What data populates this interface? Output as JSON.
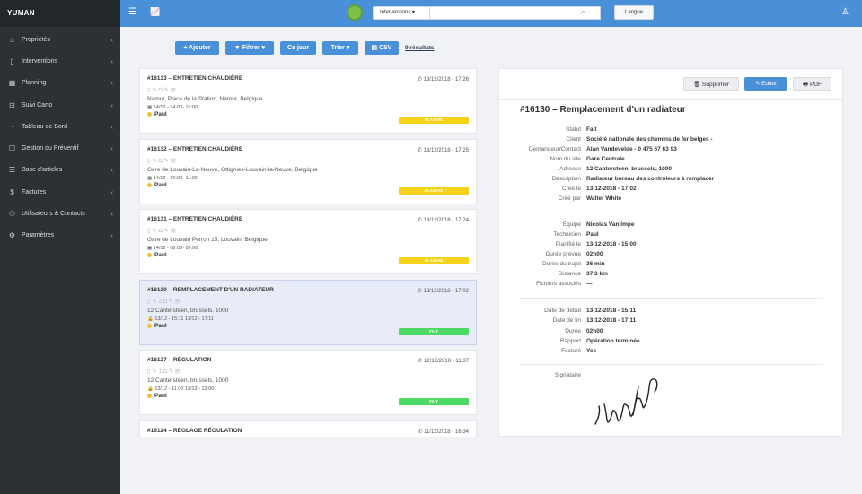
{
  "sidebar": {
    "logo": "YUMAN",
    "items": [
      {
        "label": "Propriétés",
        "icon": "home-icon",
        "glyph": "⌂",
        "chevron": true
      },
      {
        "label": "Interventions",
        "icon": "mobile-icon",
        "glyph": "▯",
        "chevron": true
      },
      {
        "label": "Planning",
        "icon": "calendar-icon",
        "glyph": "▦",
        "chevron": true
      },
      {
        "label": "Suivi Carto",
        "icon": "map-icon",
        "glyph": "⊡",
        "chevron": true
      },
      {
        "label": "Tableau de Bord",
        "icon": "dashboard-icon",
        "glyph": "◔",
        "chevron": true
      },
      {
        "label": "Gestion du Préventif",
        "icon": "square-icon",
        "glyph": "☐",
        "chevron": true
      },
      {
        "label": "Base d'articles",
        "icon": "list-icon",
        "glyph": "☰",
        "chevron": true
      },
      {
        "label": "Factures",
        "icon": "dollar-icon",
        "glyph": "$",
        "chevron": true
      },
      {
        "label": "Utilisateurs & Contacts",
        "icon": "users-icon",
        "glyph": "⚇",
        "chevron": true
      },
      {
        "label": "Paramètres",
        "icon": "gear-icon",
        "glyph": "⚙",
        "chevron": true
      }
    ]
  },
  "topbar": {
    "menu_icon": "☰",
    "chart_icon": "📈",
    "select_value": "Interventions ▾",
    "search_placeholder": "",
    "search_icon": "⌕",
    "language_button": "Langue",
    "user_icon": "♙"
  },
  "toolbar": {
    "add": "+ Ajouter",
    "filter": "▼ Filtrer ▾",
    "today": "Ce jour",
    "sort": "Trier ▾",
    "csv": "▤ CSV",
    "results": "9 résultats"
  },
  "list": [
    {
      "title": "#16133 – ENTRETIEN CHAUDIÈRE",
      "date": "13/12/2018 - 17:26",
      "icons": "▯ ✎ ◘ ✎ ▤",
      "address": "Namur, Place de la Station, Namur, Belgique",
      "slot": "▦ 14/12 - 14:00- 15:00",
      "tech": "Paul",
      "status": "PLANIFIÉ",
      "status_class": "planifie",
      "active": false
    },
    {
      "title": "#16132 – ENTRETIEN CHAUDIÈRE",
      "date": "13/12/2018 - 17:25",
      "icons": "▯ ✎ ◘ ✎ ▤",
      "address": "Gare de Louvain-La-Neuve, Ottignies-Louvain-la-Neuve, Belgique",
      "slot": "▦ 14/12 - 10:00- 11:00",
      "tech": "Paul",
      "status": "PLANIFIÉ",
      "status_class": "planifie",
      "active": false
    },
    {
      "title": "#16131 – ENTRETIEN CHAUDIÈRE",
      "date": "13/12/2018 - 17:24",
      "icons": "▯ ✎ ◘ ✎ ▤",
      "address": "Gare de Louvain Perron 15, Louvain, Belgique",
      "slot": "▦ 14/12 - 08:00- 09:00",
      "tech": "Paul",
      "status": "PLANIFIÉ",
      "status_class": "planifie",
      "active": false
    },
    {
      "title": "#16130 – REMPLACEMENT D'UN RADIATEUR",
      "date": "13/12/2018 - 17:02",
      "icons": "▯ ✎ 2 ◘ ✎ ▤",
      "address": "12 Cantersteen, brussels, 1000",
      "slot": "🔒 13/12 - 15:11 13/12 - 17:11",
      "tech": "Paul",
      "status": "FAIT",
      "status_class": "fait",
      "active": true
    },
    {
      "title": "#16127 – RÉGULATION",
      "date": "12/12/2018 - 11:37",
      "icons": "▯ ✎ 1 ◘ ✎ ▤",
      "address": "12 Cantersteen, brussels, 1000",
      "slot": "🔒 13/12 - 11:00 13/12 - 12:00",
      "tech": "Paul",
      "status": "FAIT",
      "status_class": "fait",
      "active": false
    },
    {
      "title": "#16124 – RÉGLAGE RÉGULATION",
      "date": "11/12/2018 - 16:34",
      "icons": "",
      "address": "",
      "slot": "",
      "tech": "",
      "status": "",
      "status_class": "",
      "active": false
    }
  ],
  "detail": {
    "delete": "🗑 Supprimer",
    "edit": "✎ Editer",
    "pdf": "🖶 PDF",
    "title": "#16130 – Remplacement d'un radiateur",
    "group1": [
      {
        "k": "Statut",
        "v": "Fait"
      },
      {
        "k": "Client",
        "v": "Société nationale des chemins de fer belges -"
      },
      {
        "k": "Demandeur/Contact",
        "v": "Alan Vandevelde - 0 475 67 63 93"
      },
      {
        "k": "Nom du site",
        "v": "Gare Centrale"
      },
      {
        "k": "Adresse",
        "v": "12 Cantersteen, brussels, 1000"
      },
      {
        "k": "Description",
        "v": "Radiateur bureau des contrôleurs à remplacer"
      },
      {
        "k": "Créé le",
        "v": "13-12-2018 - 17:02"
      },
      {
        "k": "Créé par",
        "v": "Walter White"
      }
    ],
    "group2": [
      {
        "k": "Equipe",
        "v": "Nicolas Van Impe"
      },
      {
        "k": "Technicien",
        "v": "Paul"
      },
      {
        "k": "Planifié le",
        "v": "13-12-2018 - 15:00"
      },
      {
        "k": "Durée prévue",
        "v": "02h00"
      },
      {
        "k": "Durée du trajet",
        "v": "36 min"
      },
      {
        "k": "Distance",
        "v": "37.3 km"
      },
      {
        "k": "Fichiers associés",
        "v": "—"
      }
    ],
    "group3": [
      {
        "k": "Date de début",
        "v": "13-12-2018 - 15:11"
      },
      {
        "k": "Date de fin",
        "v": "13-12-2018 - 17:11"
      },
      {
        "k": "Durée",
        "v": "02h00"
      },
      {
        "k": "Rapport",
        "v": "Opération terminée"
      },
      {
        "k": "Facturé",
        "v": "Yes"
      }
    ],
    "signature_label": "Signataire"
  }
}
